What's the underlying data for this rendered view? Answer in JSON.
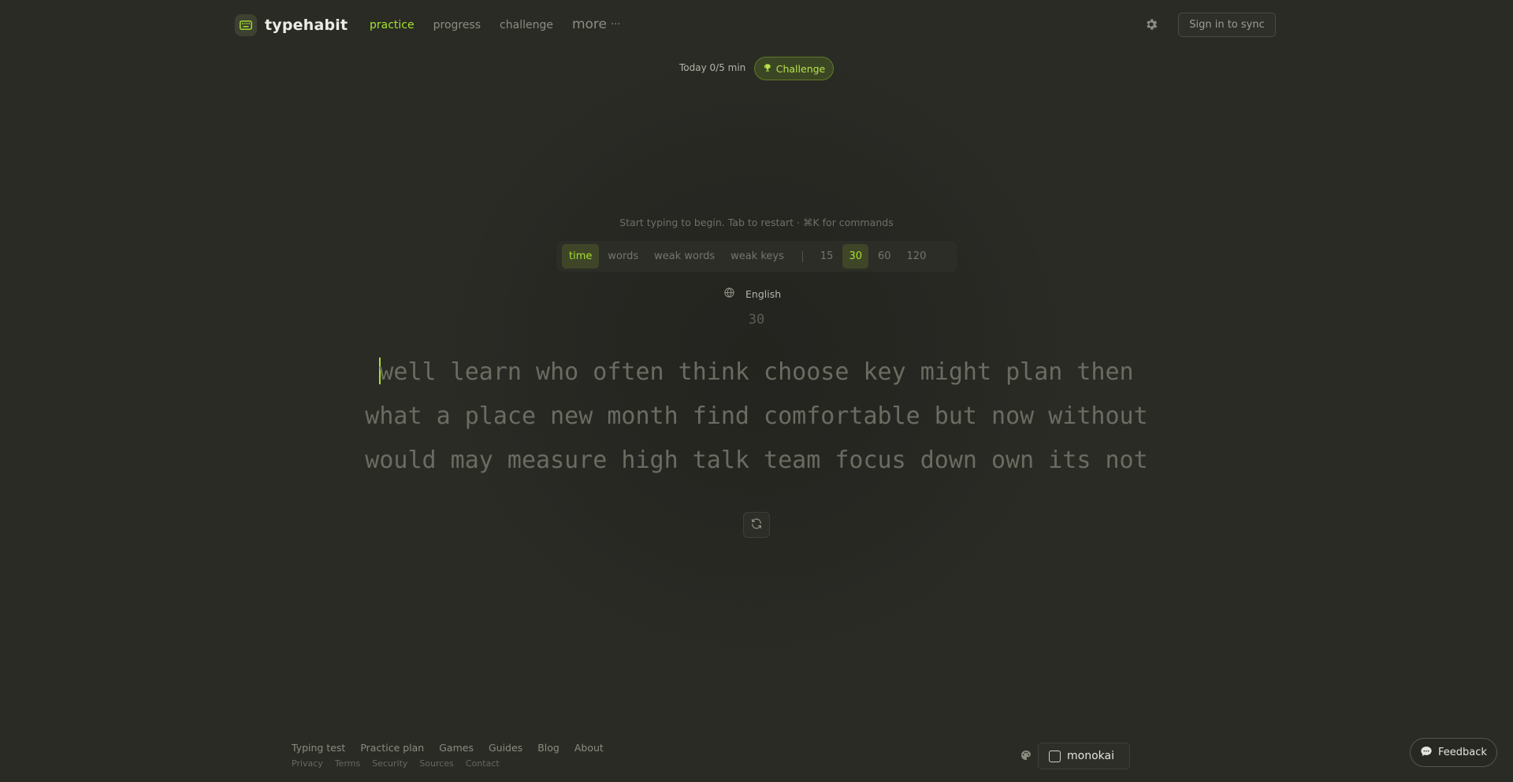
{
  "app": {
    "name": "typehabit"
  },
  "nav": {
    "items": [
      {
        "label": "practice",
        "active": true
      },
      {
        "label": "progress",
        "active": false
      },
      {
        "label": "challenge",
        "active": false
      }
    ],
    "more_label": "more",
    "more_dots": "···"
  },
  "header": {
    "signin_label": "Sign in to sync"
  },
  "daily": {
    "today_label": "Today 0/5 min",
    "challenge_label": "Challenge"
  },
  "hint": "Start typing to begin. Tab to restart · ⌘K for commands",
  "modes": {
    "types": [
      "time",
      "words",
      "weak words",
      "weak keys"
    ],
    "active_type": "time",
    "durations": [
      "15",
      "30",
      "60",
      "120"
    ],
    "active_duration": "30"
  },
  "language": "English",
  "timer": "30",
  "words": {
    "lines": [
      "well learn who often think choose key might plan then",
      "what a place new month find comfortable but now without",
      "would may measure high talk team focus down own its not"
    ]
  },
  "footer": {
    "links": [
      "Typing test",
      "Practice plan",
      "Games",
      "Guides",
      "Blog",
      "About"
    ],
    "sublinks": [
      "Privacy",
      "Terms",
      "Security",
      "Sources",
      "Contact"
    ],
    "theme": "monokai",
    "feedback_label": "Feedback"
  },
  "colors": {
    "accent": "#a6e22e",
    "background": "#2a2b25",
    "text_muted": "#6b6c61"
  },
  "icons": [
    "keyboard-icon",
    "gear-icon",
    "trophy-icon",
    "globe-icon",
    "refresh-icon",
    "palette-icon",
    "chat-icon"
  ]
}
